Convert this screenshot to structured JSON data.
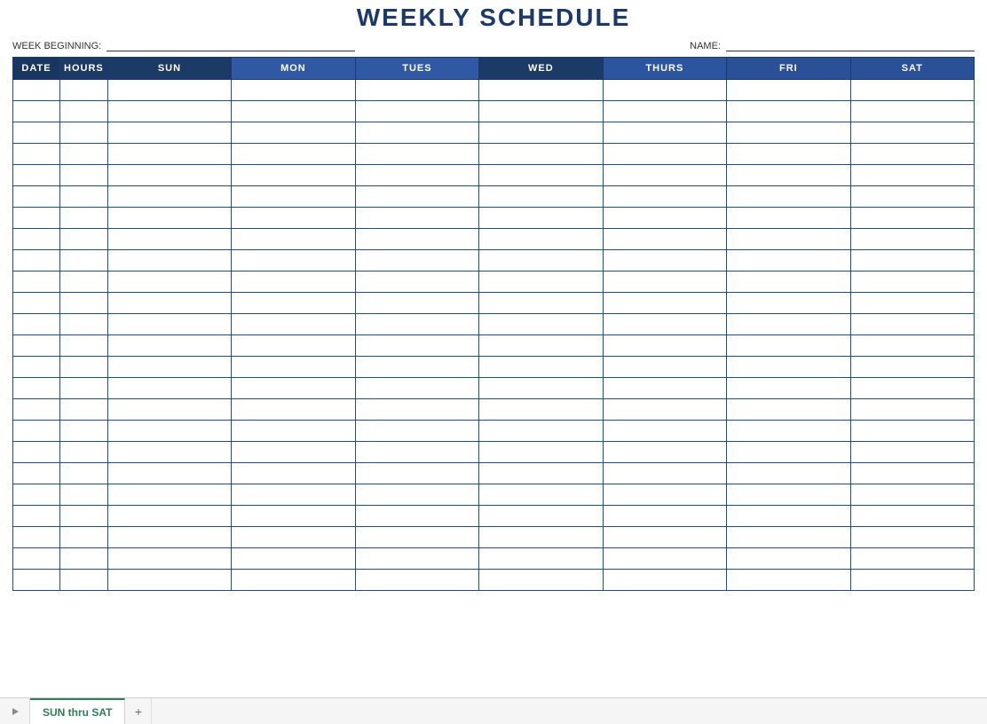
{
  "title": "WEEKLY SCHEDULE",
  "meta": {
    "week_label": "WEEK BEGINNING:",
    "week_value": "",
    "name_label": "NAME:",
    "name_value": ""
  },
  "columns": {
    "date": "DATE",
    "hours": "HOURS",
    "sun": "SUN",
    "mon": "MON",
    "tues": "TUES",
    "wed": "WED",
    "thurs": "THURS",
    "fri": "FRI",
    "sat": "SAT"
  },
  "row_count": 24,
  "rows": [
    [
      "",
      "",
      "",
      "",
      "",
      "",
      "",
      "",
      ""
    ],
    [
      "",
      "",
      "",
      "",
      "",
      "",
      "",
      "",
      ""
    ],
    [
      "",
      "",
      "",
      "",
      "",
      "",
      "",
      "",
      ""
    ],
    [
      "",
      "",
      "",
      "",
      "",
      "",
      "",
      "",
      ""
    ],
    [
      "",
      "",
      "",
      "",
      "",
      "",
      "",
      "",
      ""
    ],
    [
      "",
      "",
      "",
      "",
      "",
      "",
      "",
      "",
      ""
    ],
    [
      "",
      "",
      "",
      "",
      "",
      "",
      "",
      "",
      ""
    ],
    [
      "",
      "",
      "",
      "",
      "",
      "",
      "",
      "",
      ""
    ],
    [
      "",
      "",
      "",
      "",
      "",
      "",
      "",
      "",
      ""
    ],
    [
      "",
      "",
      "",
      "",
      "",
      "",
      "",
      "",
      ""
    ],
    [
      "",
      "",
      "",
      "",
      "",
      "",
      "",
      "",
      ""
    ],
    [
      "",
      "",
      "",
      "",
      "",
      "",
      "",
      "",
      ""
    ],
    [
      "",
      "",
      "",
      "",
      "",
      "",
      "",
      "",
      ""
    ],
    [
      "",
      "",
      "",
      "",
      "",
      "",
      "",
      "",
      ""
    ],
    [
      "",
      "",
      "",
      "",
      "",
      "",
      "",
      "",
      ""
    ],
    [
      "",
      "",
      "",
      "",
      "",
      "",
      "",
      "",
      ""
    ],
    [
      "",
      "",
      "",
      "",
      "",
      "",
      "",
      "",
      ""
    ],
    [
      "",
      "",
      "",
      "",
      "",
      "",
      "",
      "",
      ""
    ],
    [
      "",
      "",
      "",
      "",
      "",
      "",
      "",
      "",
      ""
    ],
    [
      "",
      "",
      "",
      "",
      "",
      "",
      "",
      "",
      ""
    ],
    [
      "",
      "",
      "",
      "",
      "",
      "",
      "",
      "",
      ""
    ],
    [
      "",
      "",
      "",
      "",
      "",
      "",
      "",
      "",
      ""
    ],
    [
      "",
      "",
      "",
      "",
      "",
      "",
      "",
      "",
      ""
    ],
    [
      "",
      "",
      "",
      "",
      "",
      "",
      "",
      "",
      ""
    ]
  ],
  "sheet_tabs": {
    "active": "SUN thru SAT"
  }
}
